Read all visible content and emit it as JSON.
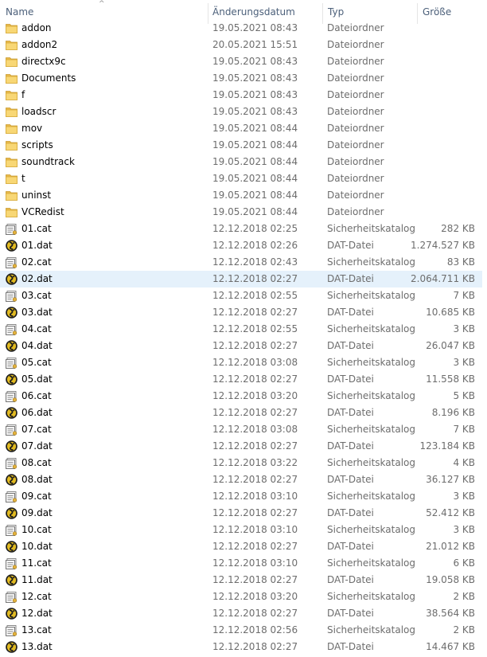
{
  "columns": {
    "name": "Name",
    "date": "Änderungsdatum",
    "type": "Typ",
    "size": "Größe"
  },
  "colors": {
    "header_text": "#4c607a",
    "selected_row": "#e5f1fb",
    "folder": "#f8d775"
  },
  "rows": [
    {
      "icon": "folder-icon",
      "name": "addon",
      "date": "19.05.2021 08:43",
      "type": "Dateiordner",
      "size": ""
    },
    {
      "icon": "folder-icon",
      "name": "addon2",
      "date": "20.05.2021 15:51",
      "type": "Dateiordner",
      "size": ""
    },
    {
      "icon": "folder-icon",
      "name": "directx9c",
      "date": "19.05.2021 08:43",
      "type": "Dateiordner",
      "size": ""
    },
    {
      "icon": "folder-icon",
      "name": "Documents",
      "date": "19.05.2021 08:43",
      "type": "Dateiordner",
      "size": ""
    },
    {
      "icon": "folder-icon",
      "name": "f",
      "date": "19.05.2021 08:43",
      "type": "Dateiordner",
      "size": ""
    },
    {
      "icon": "folder-icon",
      "name": "loadscr",
      "date": "19.05.2021 08:43",
      "type": "Dateiordner",
      "size": ""
    },
    {
      "icon": "folder-icon",
      "name": "mov",
      "date": "19.05.2021 08:44",
      "type": "Dateiordner",
      "size": ""
    },
    {
      "icon": "folder-icon",
      "name": "scripts",
      "date": "19.05.2021 08:44",
      "type": "Dateiordner",
      "size": ""
    },
    {
      "icon": "folder-icon",
      "name": "soundtrack",
      "date": "19.05.2021 08:44",
      "type": "Dateiordner",
      "size": ""
    },
    {
      "icon": "folder-icon",
      "name": "t",
      "date": "19.05.2021 08:44",
      "type": "Dateiordner",
      "size": ""
    },
    {
      "icon": "folder-icon",
      "name": "uninst",
      "date": "19.05.2021 08:44",
      "type": "Dateiordner",
      "size": ""
    },
    {
      "icon": "folder-icon",
      "name": "VCRedist",
      "date": "19.05.2021 08:44",
      "type": "Dateiordner",
      "size": ""
    },
    {
      "icon": "catalog-icon",
      "name": "01.cat",
      "date": "12.12.2018 02:25",
      "type": "Sicherheitskatalog",
      "size": "282 KB"
    },
    {
      "icon": "dat-file-icon",
      "name": "01.dat",
      "date": "12.12.2018 02:26",
      "type": "DAT-Datei",
      "size": "1.274.527 KB"
    },
    {
      "icon": "catalog-icon",
      "name": "02.cat",
      "date": "12.12.2018 02:43",
      "type": "Sicherheitskatalog",
      "size": "83 KB"
    },
    {
      "icon": "dat-file-icon",
      "name": "02.dat",
      "date": "12.12.2018 02:27",
      "type": "DAT-Datei",
      "size": "2.064.711 KB",
      "selected": true
    },
    {
      "icon": "catalog-icon",
      "name": "03.cat",
      "date": "12.12.2018 02:55",
      "type": "Sicherheitskatalog",
      "size": "7 KB"
    },
    {
      "icon": "dat-file-icon",
      "name": "03.dat",
      "date": "12.12.2018 02:27",
      "type": "DAT-Datei",
      "size": "10.685 KB"
    },
    {
      "icon": "catalog-icon",
      "name": "04.cat",
      "date": "12.12.2018 02:55",
      "type": "Sicherheitskatalog",
      "size": "3 KB"
    },
    {
      "icon": "dat-file-icon",
      "name": "04.dat",
      "date": "12.12.2018 02:27",
      "type": "DAT-Datei",
      "size": "26.047 KB"
    },
    {
      "icon": "catalog-icon",
      "name": "05.cat",
      "date": "12.12.2018 03:08",
      "type": "Sicherheitskatalog",
      "size": "3 KB"
    },
    {
      "icon": "dat-file-icon",
      "name": "05.dat",
      "date": "12.12.2018 02:27",
      "type": "DAT-Datei",
      "size": "11.558 KB"
    },
    {
      "icon": "catalog-icon",
      "name": "06.cat",
      "date": "12.12.2018 03:20",
      "type": "Sicherheitskatalog",
      "size": "5 KB"
    },
    {
      "icon": "dat-file-icon",
      "name": "06.dat",
      "date": "12.12.2018 02:27",
      "type": "DAT-Datei",
      "size": "8.196 KB"
    },
    {
      "icon": "catalog-icon",
      "name": "07.cat",
      "date": "12.12.2018 03:08",
      "type": "Sicherheitskatalog",
      "size": "7 KB"
    },
    {
      "icon": "dat-file-icon",
      "name": "07.dat",
      "date": "12.12.2018 02:27",
      "type": "DAT-Datei",
      "size": "123.184 KB"
    },
    {
      "icon": "catalog-icon",
      "name": "08.cat",
      "date": "12.12.2018 03:22",
      "type": "Sicherheitskatalog",
      "size": "4 KB"
    },
    {
      "icon": "dat-file-icon",
      "name": "08.dat",
      "date": "12.12.2018 02:27",
      "type": "DAT-Datei",
      "size": "36.127 KB"
    },
    {
      "icon": "catalog-icon",
      "name": "09.cat",
      "date": "12.12.2018 03:10",
      "type": "Sicherheitskatalog",
      "size": "3 KB"
    },
    {
      "icon": "dat-file-icon",
      "name": "09.dat",
      "date": "12.12.2018 02:27",
      "type": "DAT-Datei",
      "size": "52.412 KB"
    },
    {
      "icon": "catalog-icon",
      "name": "10.cat",
      "date": "12.12.2018 03:10",
      "type": "Sicherheitskatalog",
      "size": "3 KB"
    },
    {
      "icon": "dat-file-icon",
      "name": "10.dat",
      "date": "12.12.2018 02:27",
      "type": "DAT-Datei",
      "size": "21.012 KB"
    },
    {
      "icon": "catalog-icon",
      "name": "11.cat",
      "date": "12.12.2018 03:10",
      "type": "Sicherheitskatalog",
      "size": "6 KB"
    },
    {
      "icon": "dat-file-icon",
      "name": "11.dat",
      "date": "12.12.2018 02:27",
      "type": "DAT-Datei",
      "size": "19.058 KB"
    },
    {
      "icon": "catalog-icon",
      "name": "12.cat",
      "date": "12.12.2018 03:20",
      "type": "Sicherheitskatalog",
      "size": "2 KB"
    },
    {
      "icon": "dat-file-icon",
      "name": "12.dat",
      "date": "12.12.2018 02:27",
      "type": "DAT-Datei",
      "size": "38.564 KB"
    },
    {
      "icon": "catalog-icon",
      "name": "13.cat",
      "date": "12.12.2018 02:56",
      "type": "Sicherheitskatalog",
      "size": "2 KB"
    },
    {
      "icon": "dat-file-icon",
      "name": "13.dat",
      "date": "12.12.2018 02:27",
      "type": "DAT-Datei",
      "size": "14.467 KB"
    }
  ]
}
